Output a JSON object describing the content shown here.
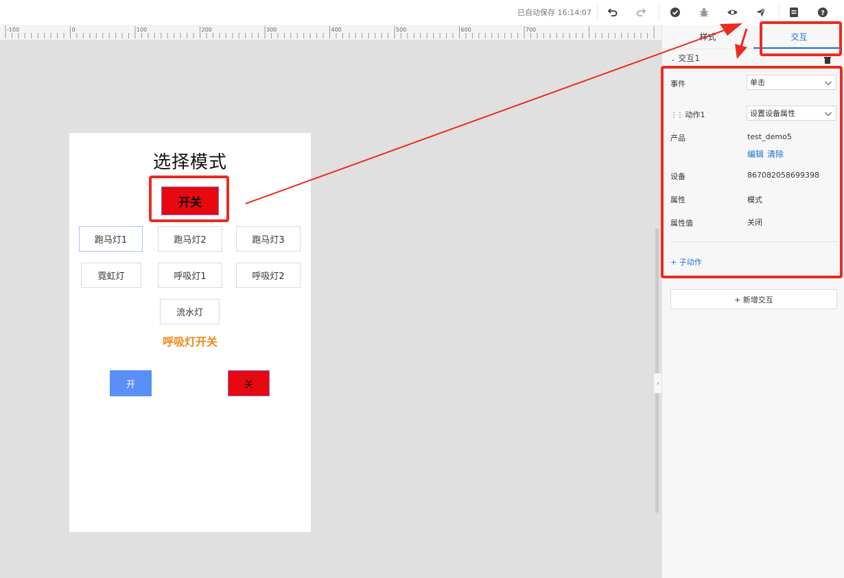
{
  "topbar": {
    "autosave": "已自动保存 16:14:07",
    "icons": [
      "undo-icon",
      "redo-icon",
      "check-icon",
      "bug-icon",
      "eye-icon",
      "send-icon",
      "doc-icon",
      "help-icon"
    ]
  },
  "ruler": {
    "labels": [
      "-100",
      "0",
      "100",
      "200",
      "300",
      "400",
      "500",
      "600",
      "700"
    ]
  },
  "page": {
    "title": "选择模式",
    "switch_label": "开关",
    "modes": [
      "跑马灯1",
      "跑马灯2",
      "跑马灯3",
      "霓虹灯",
      "呼吸灯1",
      "呼吸灯2",
      "流水灯"
    ],
    "breath_label": "呼吸灯开关",
    "on_label": "开",
    "off_label": "关"
  },
  "panel": {
    "tabs": [
      "样式",
      "交互"
    ],
    "group_title": "交互1",
    "event_label": "事件",
    "event_value": "单击",
    "action_label": "动作1",
    "action_value": "设置设备属性",
    "product_label": "产品",
    "product_value": "test_demo5",
    "edit_link": "编辑",
    "clear_link": "清除",
    "device_label": "设备",
    "device_value": "867082058699398",
    "property_label": "属性",
    "property_value": "模式",
    "property_value_label": "属性值",
    "property_value_value": "关闭",
    "sub_action_link": "+ 子动作",
    "add_interaction": "+ 新增交互"
  },
  "colors": {
    "accent": "#1e6fd9",
    "annotation": "#ec2a20",
    "switch_red": "#e8080f",
    "on_blue": "#5b8ff8",
    "breath_orange": "#f3871a"
  }
}
